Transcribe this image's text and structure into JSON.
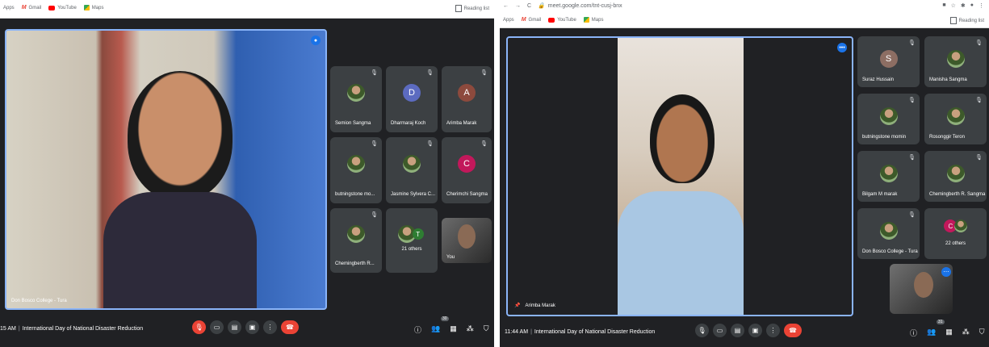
{
  "left": {
    "bookmarks": {
      "apps": "Apps",
      "gmail": "Gmail",
      "youtube": "YouTube",
      "maps": "Maps"
    },
    "reading_list": "Reading list",
    "main_speaker": "Don Bosco College - Tura",
    "tiles": [
      {
        "name": "Semion Sangma",
        "avatar": "photo"
      },
      {
        "name": "Dharmaraj Koch",
        "avatar": "D",
        "color": "#5c6bc0"
      },
      {
        "name": "Arimba Marak",
        "avatar": "A",
        "color": "#8d4a3d"
      },
      {
        "name": "butningstone mo...",
        "avatar": "photo"
      },
      {
        "name": "Jasmine Sylvera C...",
        "avatar": "photo"
      },
      {
        "name": "Cherimchi Sangma",
        "avatar": "C",
        "color": "#c2185b"
      },
      {
        "name": "Chemingberth R...",
        "avatar": "photo"
      },
      {
        "name": "21 others",
        "avatar": "T",
        "color": "#2e7d32"
      },
      {
        "name": "You",
        "avatar": "video"
      }
    ],
    "time": "15 AM",
    "meeting": "International Day of National Disaster Reduction",
    "participants_badge": "30"
  },
  "right": {
    "url": "meet.google.com/tnt-cusj-bnx",
    "bookmarks": {
      "apps": "Apps",
      "gmail": "Gmail",
      "youtube": "YouTube",
      "maps": "Maps"
    },
    "reading_list": "Reading list",
    "main_speaker": "Arimba Marak",
    "tiles": [
      {
        "name": "Suraz Hussain",
        "avatar": "S",
        "color": "#8d6e63"
      },
      {
        "name": "Manisha Sangma",
        "avatar": "photo"
      },
      {
        "name": "butningstone momin",
        "avatar": "photo"
      },
      {
        "name": "Rosonggir Teron",
        "avatar": "photo"
      },
      {
        "name": "Bilgam M marak",
        "avatar": "photo"
      },
      {
        "name": "Chemingberth R. Sangma",
        "avatar": "photo"
      },
      {
        "name": "Don Bosco College - Tura",
        "avatar": "photo"
      },
      {
        "name": "22 others",
        "avatar": "C",
        "color": "#c2185b"
      }
    ],
    "time": "11:44 AM",
    "meeting": "International Day of National Disaster Reduction",
    "participants_badge": "31"
  },
  "colors": {
    "bg": "#202124",
    "tile": "#3c4043",
    "accent": "#8ab4f8",
    "end_call": "#ea4335"
  }
}
